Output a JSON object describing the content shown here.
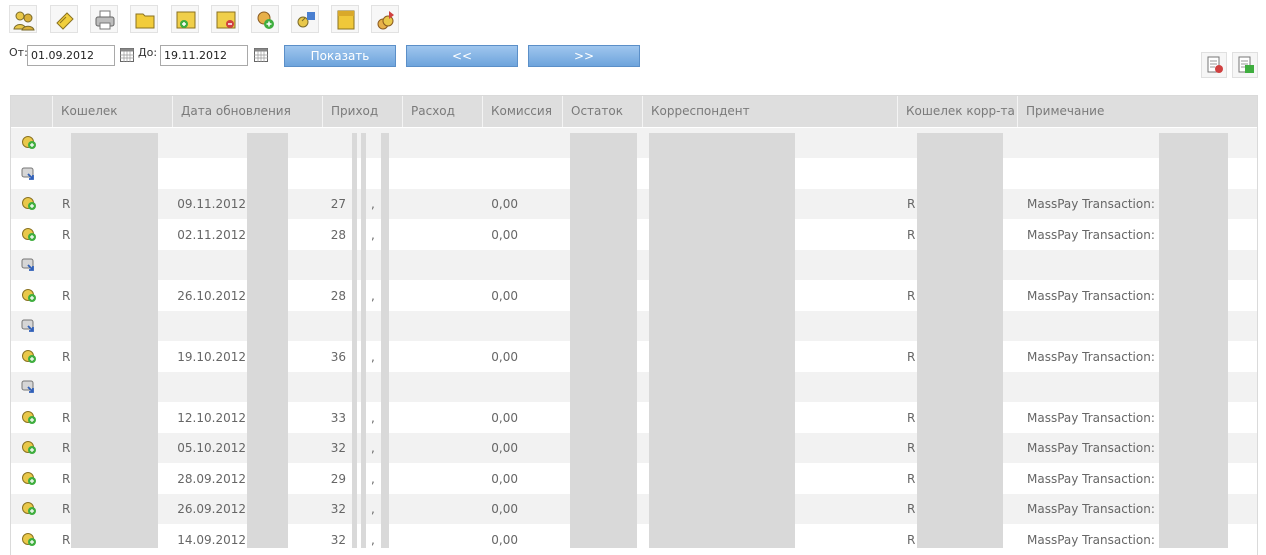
{
  "toolbar": {
    "icons": [
      "users-icon",
      "purse-icon",
      "printer-icon",
      "folder-icon",
      "add-item-icon",
      "remove-item-icon",
      "add-coin-icon",
      "exchange-icon",
      "archive-icon",
      "export-coins-icon"
    ]
  },
  "filter": {
    "from_label": "От:",
    "from_value": "01.09.2012",
    "to_label": "До:",
    "to_value": "19.11.2012",
    "show_label": "Показать",
    "prev_label": "<<",
    "next_label": ">>"
  },
  "columns": [
    "Кошелек",
    "Дата обновления",
    "Приход",
    "Расход",
    "Комиссия",
    "Остаток",
    "Корреспондент",
    "Кошелек корр-та",
    "Примечание"
  ],
  "rows": [
    {
      "type": "in",
      "wallet": "",
      "date": "",
      "income": "",
      "sep": "",
      "commission": "",
      "corr_wallet": "",
      "note": ""
    },
    {
      "type": "out",
      "wallet": "",
      "date": "",
      "income": "",
      "sep": "",
      "commission": "",
      "corr_wallet": "",
      "note": ""
    },
    {
      "type": "in",
      "wallet": "R",
      "date": "09.11.2012",
      "income": "27",
      "sep": ",",
      "commission": "0,00",
      "corr_wallet": "R",
      "note": "MassPay Transaction:"
    },
    {
      "type": "in",
      "wallet": "R",
      "date": "02.11.2012",
      "income": "28",
      "sep": ",",
      "commission": "0,00",
      "corr_wallet": "R",
      "note": "MassPay Transaction:"
    },
    {
      "type": "out",
      "wallet": "",
      "date": "",
      "income": "",
      "sep": "",
      "commission": "",
      "corr_wallet": "",
      "note": ""
    },
    {
      "type": "in",
      "wallet": "R",
      "date": "26.10.2012",
      "income": "28",
      "sep": ",",
      "commission": "0,00",
      "corr_wallet": "R",
      "note": "MassPay Transaction:"
    },
    {
      "type": "out",
      "wallet": "",
      "date": "",
      "income": "",
      "sep": "",
      "commission": "",
      "corr_wallet": "",
      "note": ""
    },
    {
      "type": "in",
      "wallet": "R",
      "date": "19.10.2012",
      "income": "36",
      "sep": ",",
      "commission": "0,00",
      "corr_wallet": "R",
      "note": "MassPay Transaction:"
    },
    {
      "type": "out",
      "wallet": "",
      "date": "",
      "income": "",
      "sep": "",
      "commission": "",
      "corr_wallet": "",
      "note": ""
    },
    {
      "type": "in",
      "wallet": "R",
      "date": "12.10.2012",
      "income": "33",
      "sep": ",",
      "commission": "0,00",
      "corr_wallet": "R",
      "note": "MassPay Transaction:"
    },
    {
      "type": "in",
      "wallet": "R",
      "date": "05.10.2012",
      "income": "32",
      "sep": ",",
      "commission": "0,00",
      "corr_wallet": "R",
      "note": "MassPay Transaction:"
    },
    {
      "type": "in",
      "wallet": "R",
      "date": "28.09.2012",
      "income": "29",
      "sep": ",",
      "commission": "0,00",
      "corr_wallet": "R",
      "note": "MassPay Transaction:"
    },
    {
      "type": "in",
      "wallet": "R",
      "date": "26.09.2012",
      "income": "32",
      "sep": ",",
      "commission": "0,00",
      "corr_wallet": "R",
      "note": "MassPay Transaction:"
    },
    {
      "type": "in",
      "wallet": "R",
      "date": "14.09.2012",
      "income": "32",
      "sep": ",",
      "commission": "0,00",
      "corr_wallet": "R",
      "note": "MassPay Transaction:"
    }
  ]
}
